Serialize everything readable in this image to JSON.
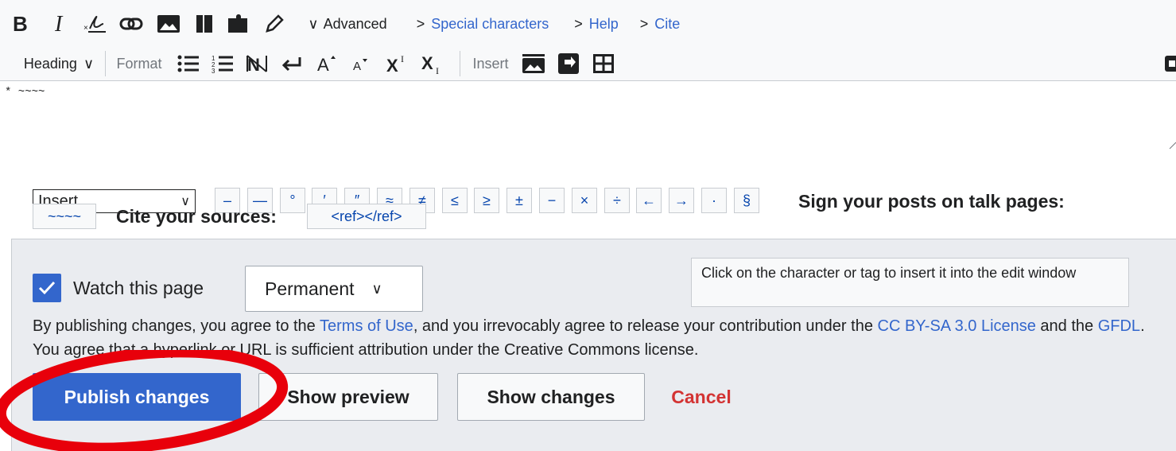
{
  "toolbar1": {
    "advanced": "Advanced",
    "special_characters": "Special characters",
    "help": "Help",
    "cite": "Cite",
    "chevron_right": ">",
    "chevron_down": "∨"
  },
  "toolbar2": {
    "heading": "Heading",
    "format": "Format",
    "insert": "Insert"
  },
  "editor": {
    "content": "* ~~~~"
  },
  "special_chars": {
    "select_value": "Insert",
    "chars": [
      "–",
      "—",
      "°",
      "′",
      "″",
      "≈",
      "≠",
      "≤",
      "≥",
      "±",
      "−",
      "×",
      "÷",
      "←",
      "→",
      "·",
      "§"
    ],
    "sign_label": "Sign your posts on talk pages:",
    "sign_chip": "~~~~",
    "cite_label": "Cite your sources:",
    "cite_chip": "<ref></ref>"
  },
  "tooltip": {
    "text": "Click on the character or tag to insert it into the edit window"
  },
  "watch": {
    "label": "Watch this page",
    "checked": true,
    "expiry": "Permanent"
  },
  "legal": {
    "part1": "By publishing changes, you agree to the ",
    "terms": "Terms of Use",
    "part2": ", and you irrevocably agree to release your contribution under the ",
    "cc": "CC BY-SA 3.0 License",
    "part3": " and the ",
    "gfdl": "GFDL",
    "part4": ". You agree that a hyperlink or URL is sufficient attribution under the Creative Commons license."
  },
  "actions": {
    "publish": "Publish changes",
    "preview": "Show preview",
    "changes": "Show changes",
    "cancel": "Cancel"
  },
  "colors": {
    "accent": "#3366cc",
    "cancel": "#d33333",
    "annotation": "#e8000b"
  }
}
